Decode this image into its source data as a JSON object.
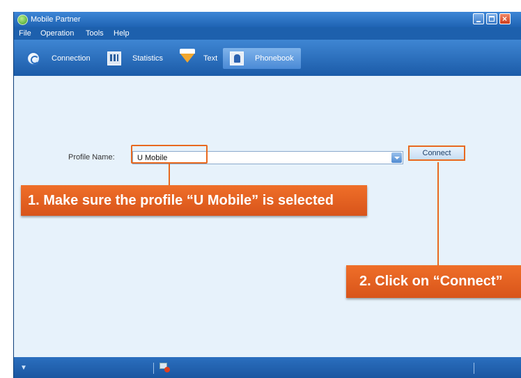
{
  "window": {
    "title": "Mobile Partner"
  },
  "menu": [
    "File",
    "Operation",
    "Tools",
    "Help"
  ],
  "tabs": [
    {
      "label": "Connection",
      "icon": "connection-icon"
    },
    {
      "label": "Statistics",
      "icon": "statistics-icon"
    },
    {
      "label": "Text",
      "icon": "text-envelope-icon"
    },
    {
      "label": "Phonebook",
      "icon": "phonebook-icon",
      "selected": true
    }
  ],
  "profile": {
    "label": "Profile Name:",
    "value": "U Mobile"
  },
  "connect_button": "Connect",
  "callouts": {
    "step1": "1. Make sure the profile “U Mobile” is selected",
    "step2": "2. Click on “Connect”"
  },
  "colors": {
    "accent": "#e8691f",
    "window_blue": "#1a5fa8",
    "content_bg": "#e7f2fb"
  }
}
